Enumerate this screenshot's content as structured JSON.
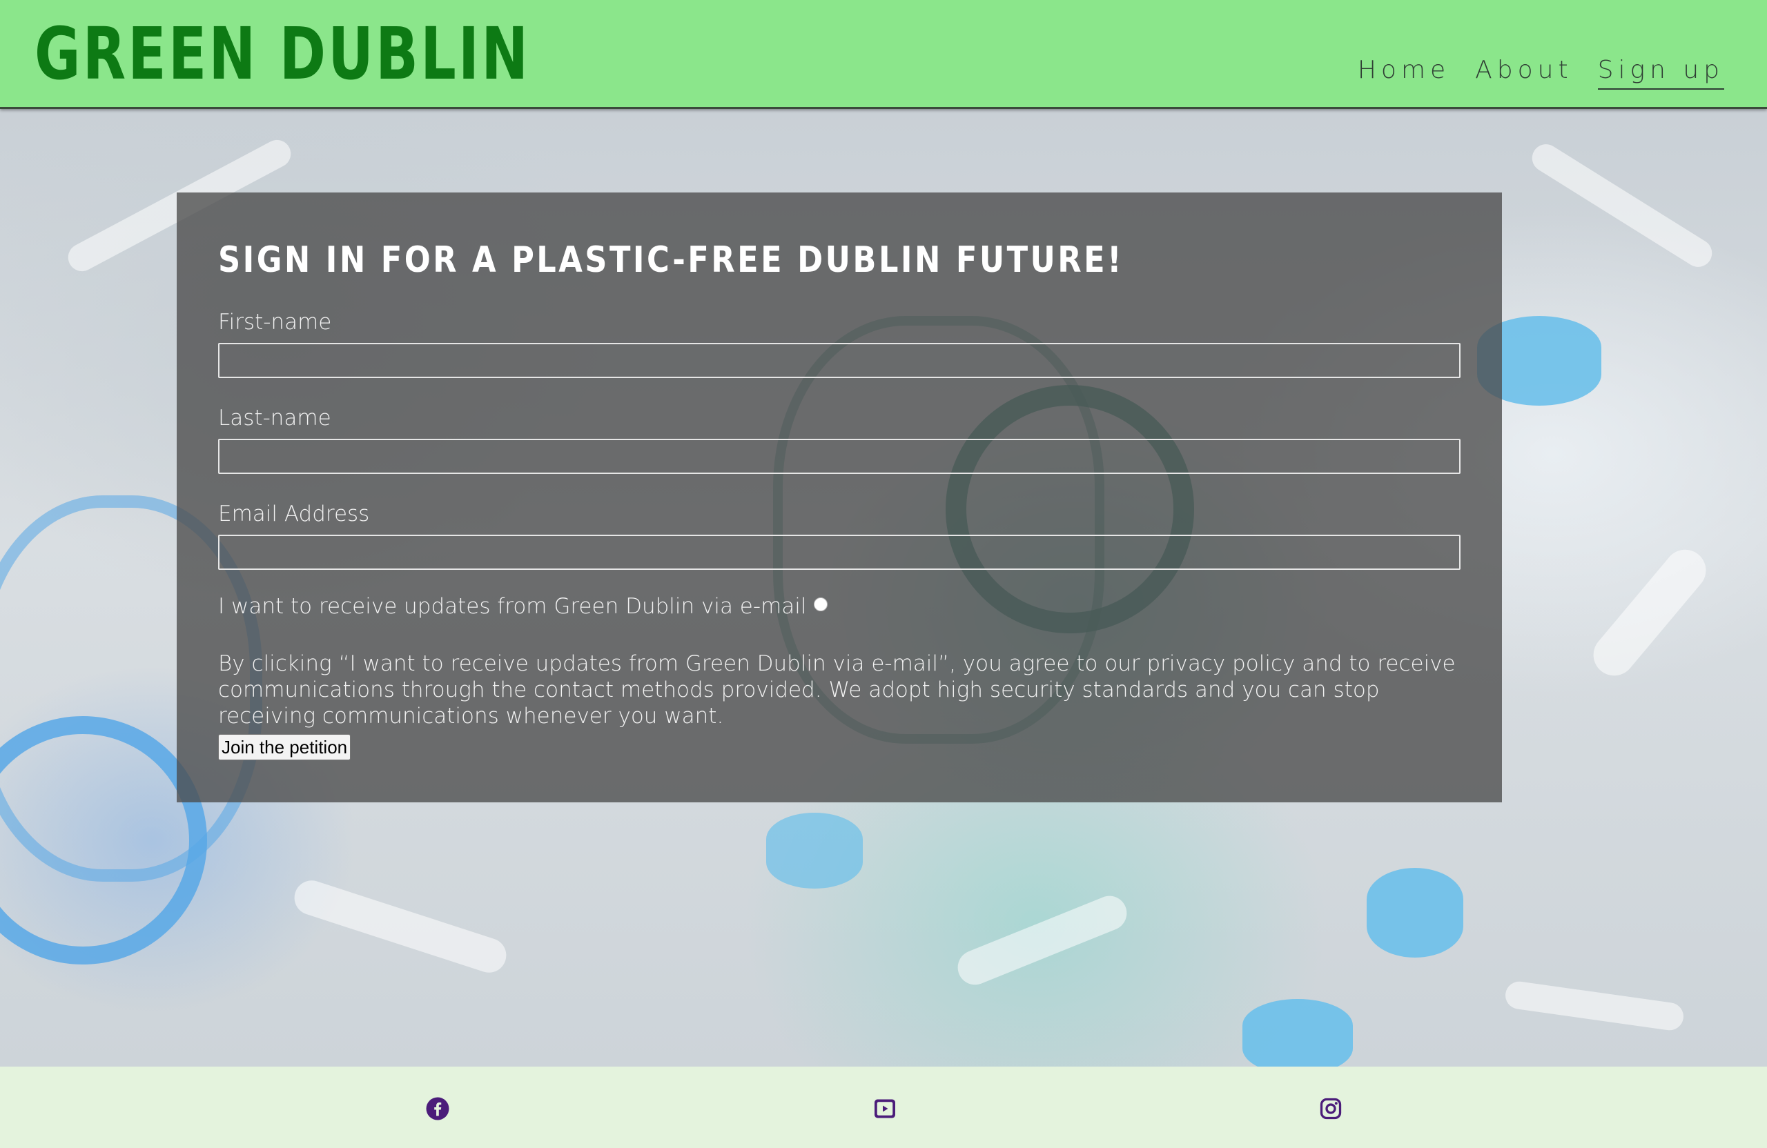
{
  "brand": {
    "name": "GREEN DUBLIN"
  },
  "nav": {
    "items": [
      {
        "label": "Home"
      },
      {
        "label": "About"
      },
      {
        "label": "Sign up"
      }
    ]
  },
  "form": {
    "heading": "SIGN IN FOR A PLASTIC-FREE DUBLIN FUTURE!",
    "first_name": {
      "label": "First-name",
      "value": ""
    },
    "last_name": {
      "label": "Last-name",
      "value": ""
    },
    "email": {
      "label": "Email Address",
      "value": ""
    },
    "consent_label": "I want to receive updates from Green Dublin via e-mail",
    "policy_text": "By clicking “I want to receive updates from Green Dublin via e-mail”, you agree to our privacy policy and to receive communications through the contact methods provided. We adopt high security standards and you can stop receiving communications whenever you want.",
    "submit_label": "Join the petition"
  },
  "footer": {
    "icons": [
      "facebook-icon",
      "youtube-icon",
      "instagram-icon"
    ]
  },
  "colors": {
    "header_bg": "#8be68b",
    "brand": "#0d7a14",
    "footer_bg": "#e4f3dd",
    "social_icon": "#4b1c7a"
  }
}
